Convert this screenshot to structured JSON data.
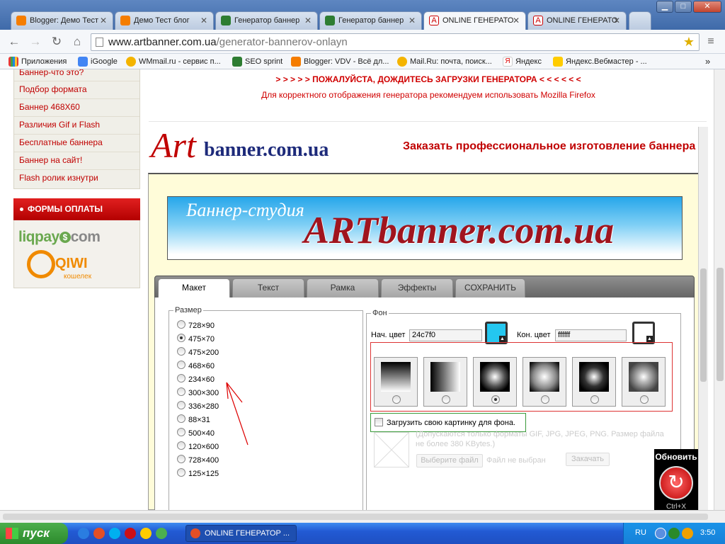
{
  "browser": {
    "tabs": [
      {
        "title": "Blogger: Демо Тест",
        "fav_color": "#f57d00"
      },
      {
        "title": "Демо Тест блог",
        "fav_color": "#f57d00"
      },
      {
        "title": "Генератор баннер",
        "fav_color": "#2e7d32"
      },
      {
        "title": "Генератор баннер",
        "fav_color": "#2e7d32"
      },
      {
        "title": "ONLINE ГЕНЕРАТО",
        "fav_color": "#ffffff",
        "active": true
      },
      {
        "title": "ONLINE ГЕНЕРАТО",
        "fav_color": "#ffffff"
      }
    ],
    "url_host": "www.artbanner.com.ua",
    "url_path": "/generator-bannerov-onlayn",
    "bookmarks": [
      {
        "label": "Приложения",
        "color": "#e53935"
      },
      {
        "label": "iGoogle",
        "color": "#4285f4"
      },
      {
        "label": "WMmail.ru - сервис п...",
        "color": "#f4b400"
      },
      {
        "label": "SEO sprint",
        "color": "#2e7d32"
      },
      {
        "label": "Blogger: VDV - Всё дл...",
        "color": "#f57d00"
      },
      {
        "label": "Mail.Ru: почта, поиск...",
        "color": "#f4b400"
      },
      {
        "label": "Яндекс",
        "color": "#ffffff"
      },
      {
        "label": "Яндекс.Вебмастер - ...",
        "color": "#ffcc00"
      }
    ],
    "bookmarks_more": "»"
  },
  "sidebar": {
    "menu_top_partial": "Баннер-что это?",
    "menu": [
      "Подбор формата",
      "Баннер 468Х60",
      "Различия Gif и Flash",
      "Бесплатные баннера",
      "Баннер на сайт!",
      "Flash ролик изнутри"
    ],
    "payment_title": "ФОРМЫ ОПЛАТЫ",
    "liqpay": "liqpay",
    "liqpay_com": "com",
    "qiwi": "QIWI",
    "qiwi_sub": "кошелек"
  },
  "page": {
    "notice1": "> > > > > ПОЖАЛУЙСТА, ДОЖДИТЕСЬ ЗАГРУЗКИ ГЕНЕРАТОРА   < < < < < <",
    "notice2": "Для корректного отображения генератора рекомендуем использовать Mozilla Firefox",
    "logo_art": "Art",
    "logo_domain": "banner.com.ua",
    "order_text": "Заказать профессиональное изготовление баннера"
  },
  "generator": {
    "banner_small": "Баннер-студия",
    "banner_big": "ARTbanner.com.ua",
    "tabs": [
      "Макет",
      "Текст",
      "Рамка",
      "Эффекты",
      "СОХРАНИТЬ"
    ],
    "active_tab": "Макет",
    "size_legend": "Размер",
    "sizes": [
      "728×90",
      "475×70",
      "475×200",
      "468×60",
      "234×60",
      "300×300",
      "336×280",
      "88×31",
      "500×40",
      "120×600",
      "728×400",
      "125×125"
    ],
    "selected_size": "475×70",
    "bg_legend": "Фон",
    "start_color_label": "Нач. цвет",
    "start_color": "24c7f0",
    "end_color_label": "Кон. цвет",
    "end_color": "ffffff",
    "selected_gradient": 3,
    "upload_label": "Загрузить свою картинку для фона.",
    "upload_hint": "(Допускаются только форматы GIF, JPG, JPEG, PNG. Размер файла не более 380 KBytes.)",
    "choose_file": "Выберите файл",
    "no_file": "Файл не выбран",
    "upload_btn": "Закачать",
    "refresh_label": "Обновить",
    "refresh_hint": "Ctrl+X"
  },
  "taskbar": {
    "start": "пуск",
    "window": "ONLINE ГЕНЕРАТОР ...",
    "lang": "RU",
    "time": "3:50"
  },
  "colors": {
    "accent_red": "#c00000",
    "generator_bg": "#fffcd9",
    "banner_blue": "#24c7f0"
  }
}
